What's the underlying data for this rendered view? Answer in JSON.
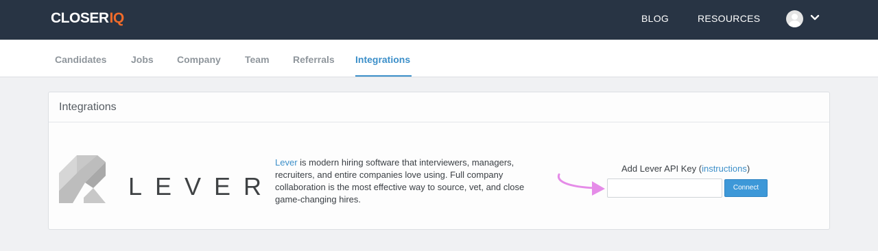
{
  "header": {
    "logo": {
      "main": "CLOSER",
      "accent": "IQ"
    },
    "nav": [
      {
        "label": "BLOG"
      },
      {
        "label": "RESOURCES"
      }
    ],
    "user_menu_icon": "chevron-down-icon"
  },
  "subnav": {
    "tabs": [
      {
        "label": "Candidates"
      },
      {
        "label": "Jobs"
      },
      {
        "label": "Company"
      },
      {
        "label": "Team"
      },
      {
        "label": "Referrals"
      },
      {
        "label": "Integrations"
      }
    ],
    "active_tab": "Integrations"
  },
  "panel": {
    "title": "Integrations",
    "integration": {
      "logo_word": "LEVER",
      "link_text": "Lever",
      "description": " is modern hiring software that interviewers, managers, recruiters, and entire companies love using. Full company collaboration is the most effective way to source, vet, and close game-changing hires.",
      "api_label_prefix": "Add Lever API Key (",
      "api_label_link": "instructions",
      "api_label_suffix": ")",
      "api_input_value": "",
      "connect_label": "Connect"
    }
  },
  "colors": {
    "topbar": "#283444",
    "accent": "#3c8fc9",
    "logo_accent": "#f06b2a",
    "arrow": "#e58ce8"
  }
}
